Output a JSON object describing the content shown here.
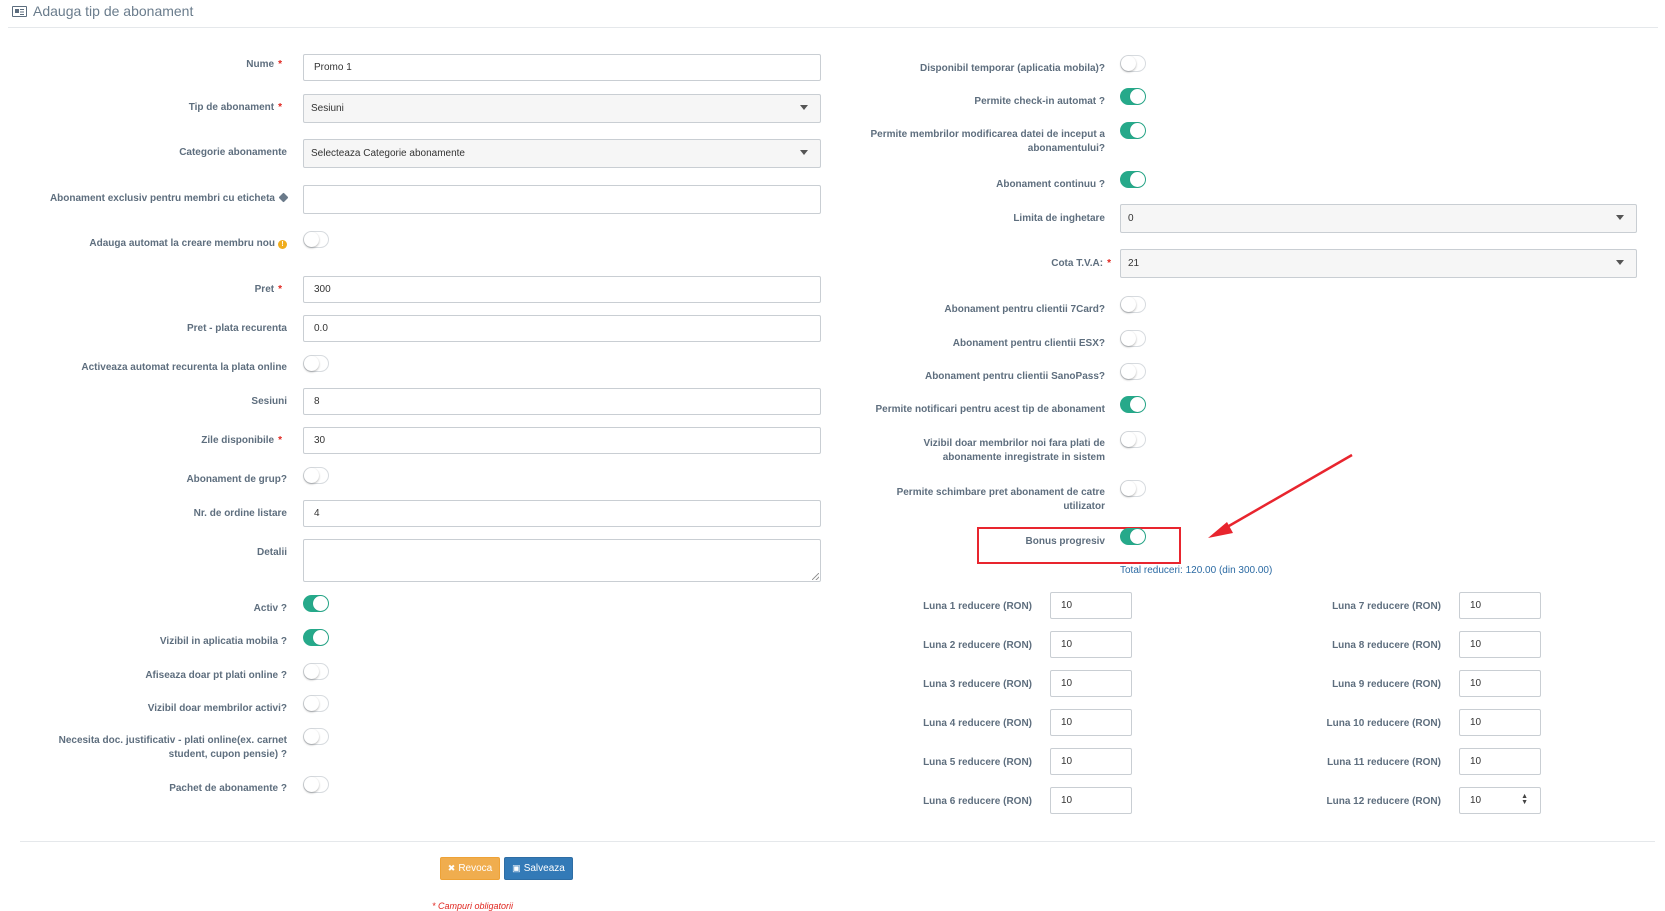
{
  "header": {
    "title": "Adauga tip de abonament",
    "icon": "id-card-icon"
  },
  "left_fields": {
    "nume": {
      "label": "Nume",
      "value": "Promo 1",
      "required": "*"
    },
    "tip": {
      "label": "Tip de abonament",
      "value": "Sesiuni",
      "required": "*"
    },
    "categorie": {
      "label": "Categorie abonamente",
      "value": "Selecteaza Categorie abonamente"
    },
    "exclusiv": {
      "label": "Abonament exclusiv pentru membri cu eticheta",
      "value": ""
    },
    "adauga_automat": {
      "label": "Adauga automat la creare membru nou",
      "on": false
    },
    "pret": {
      "label": "Pret",
      "value": "300",
      "required": "*"
    },
    "pret_recurent": {
      "label": "Pret - plata recurenta",
      "value": "0.0"
    },
    "activeaza_recurenta": {
      "label": "Activeaza automat recurenta la plata online",
      "on": false
    },
    "sesiuni": {
      "label": "Sesiuni",
      "value": "8"
    },
    "zile": {
      "label": "Zile disponibile",
      "value": "30",
      "required": "*"
    },
    "grup": {
      "label": "Abonament de grup?",
      "on": false
    },
    "ordine": {
      "label": "Nr. de ordine listare",
      "value": "4"
    },
    "detalii": {
      "label": "Detalii",
      "value": ""
    },
    "activ": {
      "label": "Activ ?",
      "on": true
    },
    "vizibil_app": {
      "label": "Vizibil in aplicatia mobila ?",
      "on": true
    },
    "plati_online": {
      "label": "Afiseaza doar pt plati online ?",
      "on": false
    },
    "membri_activi": {
      "label": "Vizibil doar membrilor activi?",
      "on": false
    },
    "doc_justificativ": {
      "label_line1": "Necesita doc. justificativ - plati online(ex. carnet",
      "label_line2": "student, cupon pensie) ?",
      "on": false
    },
    "pachet": {
      "label": "Pachet de abonamente ?",
      "on": false
    }
  },
  "right_fields": {
    "disponibil_temporar": {
      "label": "Disponibil temporar (aplicatia mobila)?",
      "on": false
    },
    "checkin": {
      "label": "Permite check-in automat ?",
      "on": true
    },
    "modificare_data": {
      "label_line1": "Permite membrilor modificarea datei de inceput a",
      "label_line2": "abonamentului?",
      "on": true
    },
    "continuu": {
      "label": "Abonament continuu ?",
      "on": true
    },
    "inghetare": {
      "label": "Limita de inghetare",
      "value": "0"
    },
    "tva": {
      "label": "Cota T.V.A:",
      "value": "21",
      "required": "*"
    },
    "card7": {
      "label": "Abonament pentru clientii 7Card?",
      "on": false
    },
    "esx": {
      "label": "Abonament pentru clientii ESX?",
      "on": false
    },
    "sanopass": {
      "label": "Abonament pentru clientii SanoPass?",
      "on": false
    },
    "notificari": {
      "label": "Permite notificari pentru acest tip de abonament",
      "on": true
    },
    "vizibil_noi": {
      "label_line1": "Vizibil doar membrilor noi fara plati de",
      "label_line2": "abonamente inregistrate in sistem",
      "on": false
    },
    "schimbare_pret": {
      "label_line1": "Permite schimbare pret abonament de catre",
      "label_line2": "utilizator",
      "on": false
    },
    "bonus": {
      "label": "Bonus progresiv",
      "on": true
    },
    "total_reduceri": "Total reduceri: 120.00 (din 300.00)"
  },
  "months_left": [
    {
      "label": "Luna 1 reducere (RON)",
      "value": "10"
    },
    {
      "label": "Luna 2 reducere (RON)",
      "value": "10"
    },
    {
      "label": "Luna 3 reducere (RON)",
      "value": "10"
    },
    {
      "label": "Luna 4 reducere (RON)",
      "value": "10"
    },
    {
      "label": "Luna 5 reducere (RON)",
      "value": "10"
    },
    {
      "label": "Luna 6 reducere (RON)",
      "value": "10"
    }
  ],
  "months_right": [
    {
      "label": "Luna 7 reducere (RON)",
      "value": "10"
    },
    {
      "label": "Luna 8 reducere (RON)",
      "value": "10"
    },
    {
      "label": "Luna 9 reducere (RON)",
      "value": "10"
    },
    {
      "label": "Luna 10 reducere (RON)",
      "value": "10"
    },
    {
      "label": "Luna 11 reducere (RON)",
      "value": "10"
    },
    {
      "label": "Luna 12 reducere (RON)",
      "value": "10"
    }
  ],
  "buttons": {
    "cancel": "Revoca",
    "save": "Salveaza"
  },
  "required_note": "* Campuri obligatorii",
  "colors": {
    "toggle_on": "#26a98a",
    "annotation": "#e8252e",
    "save": "#337ab7",
    "cancel": "#f0ad4e"
  }
}
